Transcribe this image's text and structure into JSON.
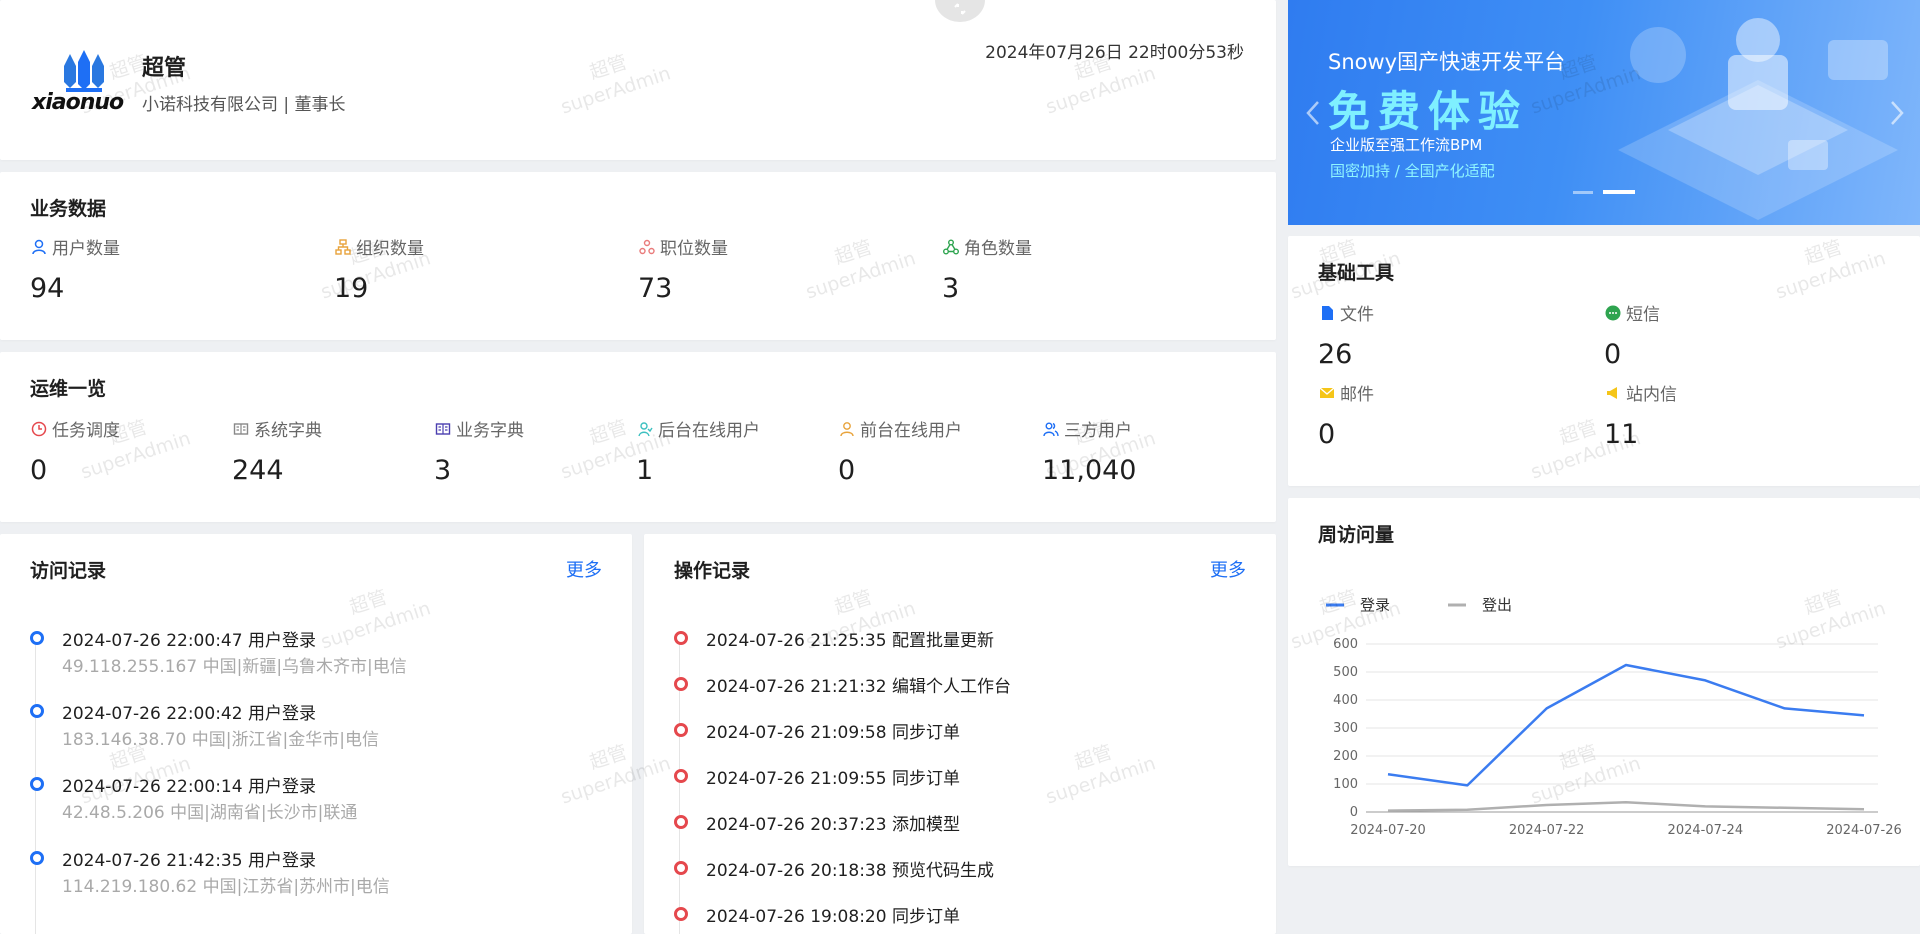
{
  "header": {
    "user_name": "超管",
    "org_position": "小诺科技有限公司 | 董事长",
    "datetime": "2024年07月26日 22时00分53秒",
    "logo_text": "xiaonuo"
  },
  "business_data": {
    "title": "业务数据",
    "items": [
      {
        "label": "用户数量",
        "value": "94",
        "icon": "user-icon",
        "color": "#1e6ff5"
      },
      {
        "label": "组织数量",
        "value": "19",
        "icon": "org-icon",
        "color": "#e8a33b"
      },
      {
        "label": "职位数量",
        "value": "73",
        "icon": "position-icon",
        "color": "#e97b7b"
      },
      {
        "label": "角色数量",
        "value": "3",
        "icon": "role-icon",
        "color": "#2ea44f"
      }
    ]
  },
  "ops_overview": {
    "title": "运维一览",
    "items": [
      {
        "label": "任务调度",
        "value": "0",
        "icon": "clock-icon",
        "color": "#e5484d"
      },
      {
        "label": "系统字典",
        "value": "244",
        "icon": "book-icon",
        "color": "#888888"
      },
      {
        "label": "业务字典",
        "value": "3",
        "icon": "book-open-icon",
        "color": "#4b3fb0"
      },
      {
        "label": "后台在线用户",
        "value": "1",
        "icon": "online-user-icon",
        "color": "#3cc0c0"
      },
      {
        "label": "前台在线用户",
        "value": "0",
        "icon": "front-user-icon",
        "color": "#e8a33b"
      },
      {
        "label": "三方用户",
        "value": "11,040",
        "icon": "third-user-icon",
        "color": "#1e6ff5"
      }
    ]
  },
  "visit_log": {
    "title": "访问记录",
    "more": "更多",
    "items": [
      {
        "time_event": "2024-07-26 22:00:47 用户登录",
        "detail": "49.118.255.167 中国|新疆|乌鲁木齐市|电信"
      },
      {
        "time_event": "2024-07-26 22:00:42 用户登录",
        "detail": "183.146.38.70 中国|浙江省|金华市|电信"
      },
      {
        "time_event": "2024-07-26 22:00:14 用户登录",
        "detail": "42.48.5.206 中国|湖南省|长沙市|联通"
      },
      {
        "time_event": "2024-07-26 21:42:35 用户登录",
        "detail": "114.219.180.62 中国|江苏省|苏州市|电信"
      }
    ]
  },
  "op_log": {
    "title": "操作记录",
    "more": "更多",
    "items": [
      {
        "time_event": "2024-07-26 21:25:35 配置批量更新"
      },
      {
        "time_event": "2024-07-26 21:21:32 编辑个人工作台"
      },
      {
        "time_event": "2024-07-26 21:09:58 同步订单"
      },
      {
        "time_event": "2024-07-26 21:09:55 同步订单"
      },
      {
        "time_event": "2024-07-26 20:37:23 添加模型"
      },
      {
        "time_event": "2024-07-26 20:18:38 预览代码生成"
      },
      {
        "time_event": "2024-07-26 19:08:20 同步订单"
      }
    ]
  },
  "banner": {
    "headline": "Snowy国产快速开发平台",
    "big": "免费体验",
    "line1": "企业版至强工作流BPM",
    "line2": "国密加持 / 全国产化适配"
  },
  "basic_tools": {
    "title": "基础工具",
    "items": [
      {
        "label": "文件",
        "value": "26",
        "icon": "file-icon",
        "color": "#1e6ff5"
      },
      {
        "label": "短信",
        "value": "0",
        "icon": "sms-icon",
        "color": "#2ea44f"
      },
      {
        "label": "邮件",
        "value": "0",
        "icon": "mail-icon",
        "color": "#f5c518"
      },
      {
        "label": "站内信",
        "value": "11",
        "icon": "notice-icon",
        "color": "#f5c518"
      }
    ]
  },
  "weekly_visits": {
    "title": "周访问量"
  },
  "watermark": {
    "line1": "超管",
    "line2": "superAdmin"
  },
  "chart_data": {
    "type": "line",
    "x": [
      "2024-07-20",
      "2024-07-21",
      "2024-07-22",
      "2024-07-23",
      "2024-07-24",
      "2024-07-25",
      "2024-07-26"
    ],
    "x_tick_labels": [
      "2024-07-20",
      "2024-07-22",
      "2024-07-24",
      "2024-07-26"
    ],
    "series": [
      {
        "name": "登录",
        "values": [
          135,
          95,
          370,
          525,
          470,
          370,
          345
        ],
        "color": "#3b7cf0"
      },
      {
        "name": "登出",
        "values": [
          5,
          8,
          25,
          35,
          20,
          15,
          10
        ],
        "color": "#b0b0b0"
      }
    ],
    "ylim": [
      0,
      600
    ],
    "yticks": [
      0,
      100,
      200,
      300,
      400,
      500,
      600
    ],
    "grid": true,
    "legend": "top-left"
  }
}
